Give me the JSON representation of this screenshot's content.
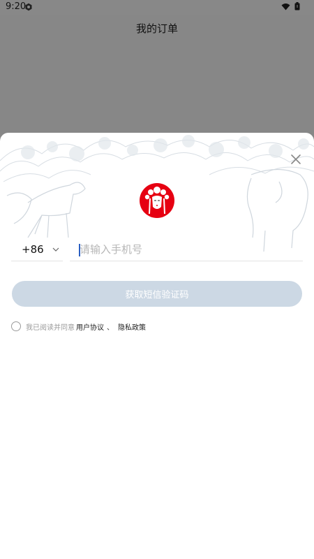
{
  "status_bar": {
    "time": "9:20"
  },
  "page": {
    "title": "我的订单"
  },
  "login": {
    "country_code": "+86",
    "phone_placeholder": "请输入手机号",
    "sms_button_label": "获取短信验证码",
    "agree_prefix": "我已阅读并同意",
    "user_agreement": "用户协议",
    "separator": "、",
    "privacy_policy": "隐私政策"
  },
  "colors": {
    "overlay": "#878787",
    "button_disabled": "#ccd8e4",
    "logo_red": "#e60012",
    "caret": "#2b5fc2"
  },
  "icons": [
    "gear-icon",
    "wifi-icon",
    "battery-icon",
    "close-icon",
    "chevron-down-icon",
    "opera-mask-logo"
  ]
}
